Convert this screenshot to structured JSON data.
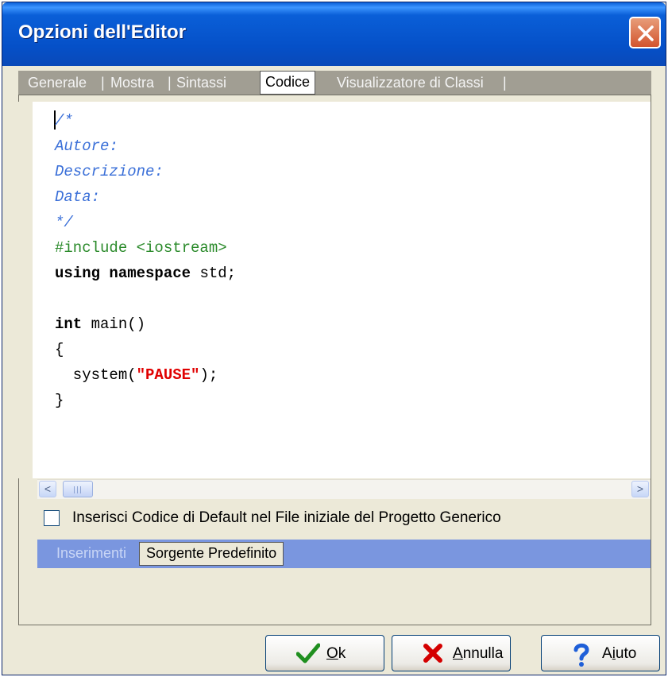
{
  "window": {
    "title": "Opzioni dell'Editor"
  },
  "tabs": [
    {
      "label": "Generale",
      "active": false
    },
    {
      "label": "Mostra",
      "active": false
    },
    {
      "label": "Sintassi",
      "active": false
    },
    {
      "label": "Codice",
      "active": true
    },
    {
      "label": "Visualizzatore di Classi",
      "active": false
    }
  ],
  "tab_separator": "|",
  "editor": {
    "lines": [
      {
        "type": "comment",
        "text": "/*"
      },
      {
        "type": "comment",
        "text": "Autore:"
      },
      {
        "type": "comment",
        "text": "Descrizione:"
      },
      {
        "type": "comment",
        "text": "Data:"
      },
      {
        "type": "comment",
        "text": "*/"
      },
      {
        "type": "preprocessor",
        "text": "#include <iostream>"
      },
      {
        "type": "using",
        "kw1": "using",
        "kw2": "namespace",
        "rest": " std;"
      },
      {
        "type": "blank",
        "text": ""
      },
      {
        "type": "func",
        "kw": "int",
        "rest": " main()"
      },
      {
        "type": "plain",
        "text": "{"
      },
      {
        "type": "call",
        "pre": "  system(",
        "str": "\"PAUSE\"",
        "post": ");"
      },
      {
        "type": "plain",
        "text": "}"
      }
    ]
  },
  "scrollbar": {
    "left_arrow": "<",
    "right_arrow": ">"
  },
  "checkbox": {
    "label": "Inserisci Codice di Default nel File iniziale del Progetto Generico",
    "checked": false
  },
  "subtabs": [
    {
      "label": "Inserimenti",
      "active": false
    },
    {
      "label": "Sorgente Predefinito",
      "active": true
    }
  ],
  "buttons": {
    "ok": {
      "mnemonic": "O",
      "rest": "k",
      "icon": "checkmark-icon"
    },
    "cancel": {
      "mnemonic": "A",
      "rest": "nnulla",
      "icon": "red-x-icon"
    },
    "help": {
      "prefix": "A",
      "mnemonic": "i",
      "rest": "uto",
      "icon": "question-icon"
    }
  },
  "colors": {
    "titlebar": "#0550c8",
    "comment": "#3a6fd8",
    "preprocessor": "#2a8a2a",
    "string": "#e00000",
    "subtab_bar": "#7a96df",
    "close_button": "#d2542e"
  }
}
